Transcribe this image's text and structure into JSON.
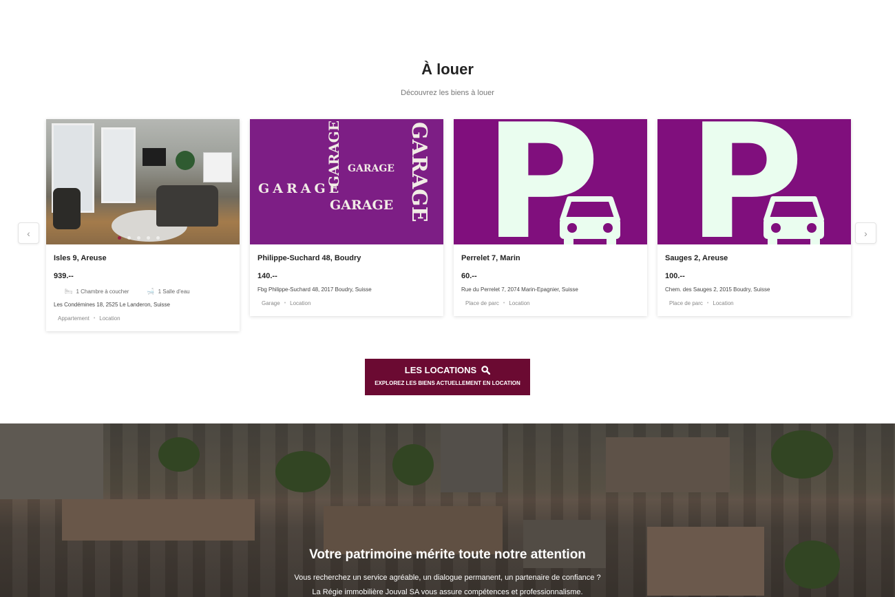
{
  "section": {
    "title": "À louer",
    "subtitle": "Découvrez les biens à louer"
  },
  "carousel": {
    "prev_icon": "chevron-left-icon",
    "next_icon": "chevron-right-icon",
    "prev_glyph": "‹",
    "next_glyph": "›"
  },
  "listings": [
    {
      "title": "Isles 9, Areuse",
      "price": "939.--",
      "bedrooms": "1 Chambre à coucher",
      "bathrooms": "1 Salle d'eau",
      "address": "Les Condémines 18, 2525 Le Landeron, Suisse",
      "type": "Appartement",
      "category": "Location",
      "image": "living-room-photo",
      "slides": 5,
      "active_slide": 1
    },
    {
      "title": "Philippe-Suchard 48, Boudry",
      "price": "140.--",
      "address": "Fbg Philippe-Suchard 48, 2017 Boudry, Suisse",
      "type": "Garage",
      "category": "Location",
      "image": "garage-graphic",
      "garage_word": "GARAGE"
    },
    {
      "title": "Perrelet 7, Marin",
      "price": "60.--",
      "address": "Rue du Perrelet 7, 2074 Marin-Epagnier, Suisse",
      "type": "Place de parc",
      "category": "Location",
      "image": "parking-sign-graphic",
      "sign_letter": "P"
    },
    {
      "title": "Sauges 2, Areuse",
      "price": "100.--",
      "address": "Chem. des Sauges 2, 2015 Boudry, Suisse",
      "type": "Place de parc",
      "category": "Location",
      "image": "parking-sign-graphic",
      "sign_letter": "P"
    }
  ],
  "cta": {
    "title": "LES LOCATIONS",
    "subtitle": "EXPLOREZ LES BIENS ACTUELLEMENT EN LOCATION",
    "icon": "search-icon",
    "color": "#6b0a32"
  },
  "banner": {
    "heading": "Votre patrimoine mérite toute notre attention",
    "line1": "Vous recherchez un service agréable, un dialogue permanent, un partenaire de confiance ?",
    "line2": "La Régie immobilière Jouval SA vous assure compétences et professionnalisme.",
    "image": "aerial-rooftops-photo"
  },
  "colors": {
    "accent": "#6b0a32",
    "garage_bg": "#7d1e85",
    "parking_bg": "#800f7d",
    "sign_fg": "#eafdef"
  }
}
